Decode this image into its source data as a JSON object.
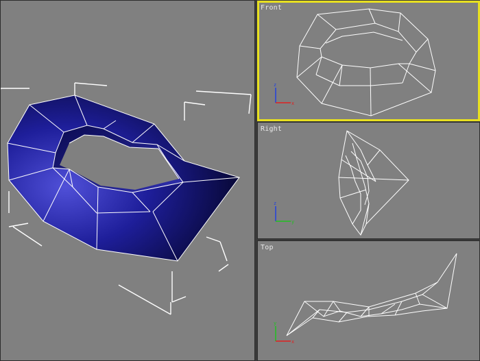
{
  "viewports": {
    "perspective": {
      "label": "",
      "active": false
    },
    "front": {
      "label": "Front",
      "active": true
    },
    "right": {
      "label": "Right",
      "active": false
    },
    "top": {
      "label": "Top",
      "active": false
    }
  },
  "axis_colors": {
    "x": "#e02020",
    "y": "#20c020",
    "z": "#2040e0"
  },
  "object_color": "#1a1a8a",
  "active_border_color": "#e8e020"
}
